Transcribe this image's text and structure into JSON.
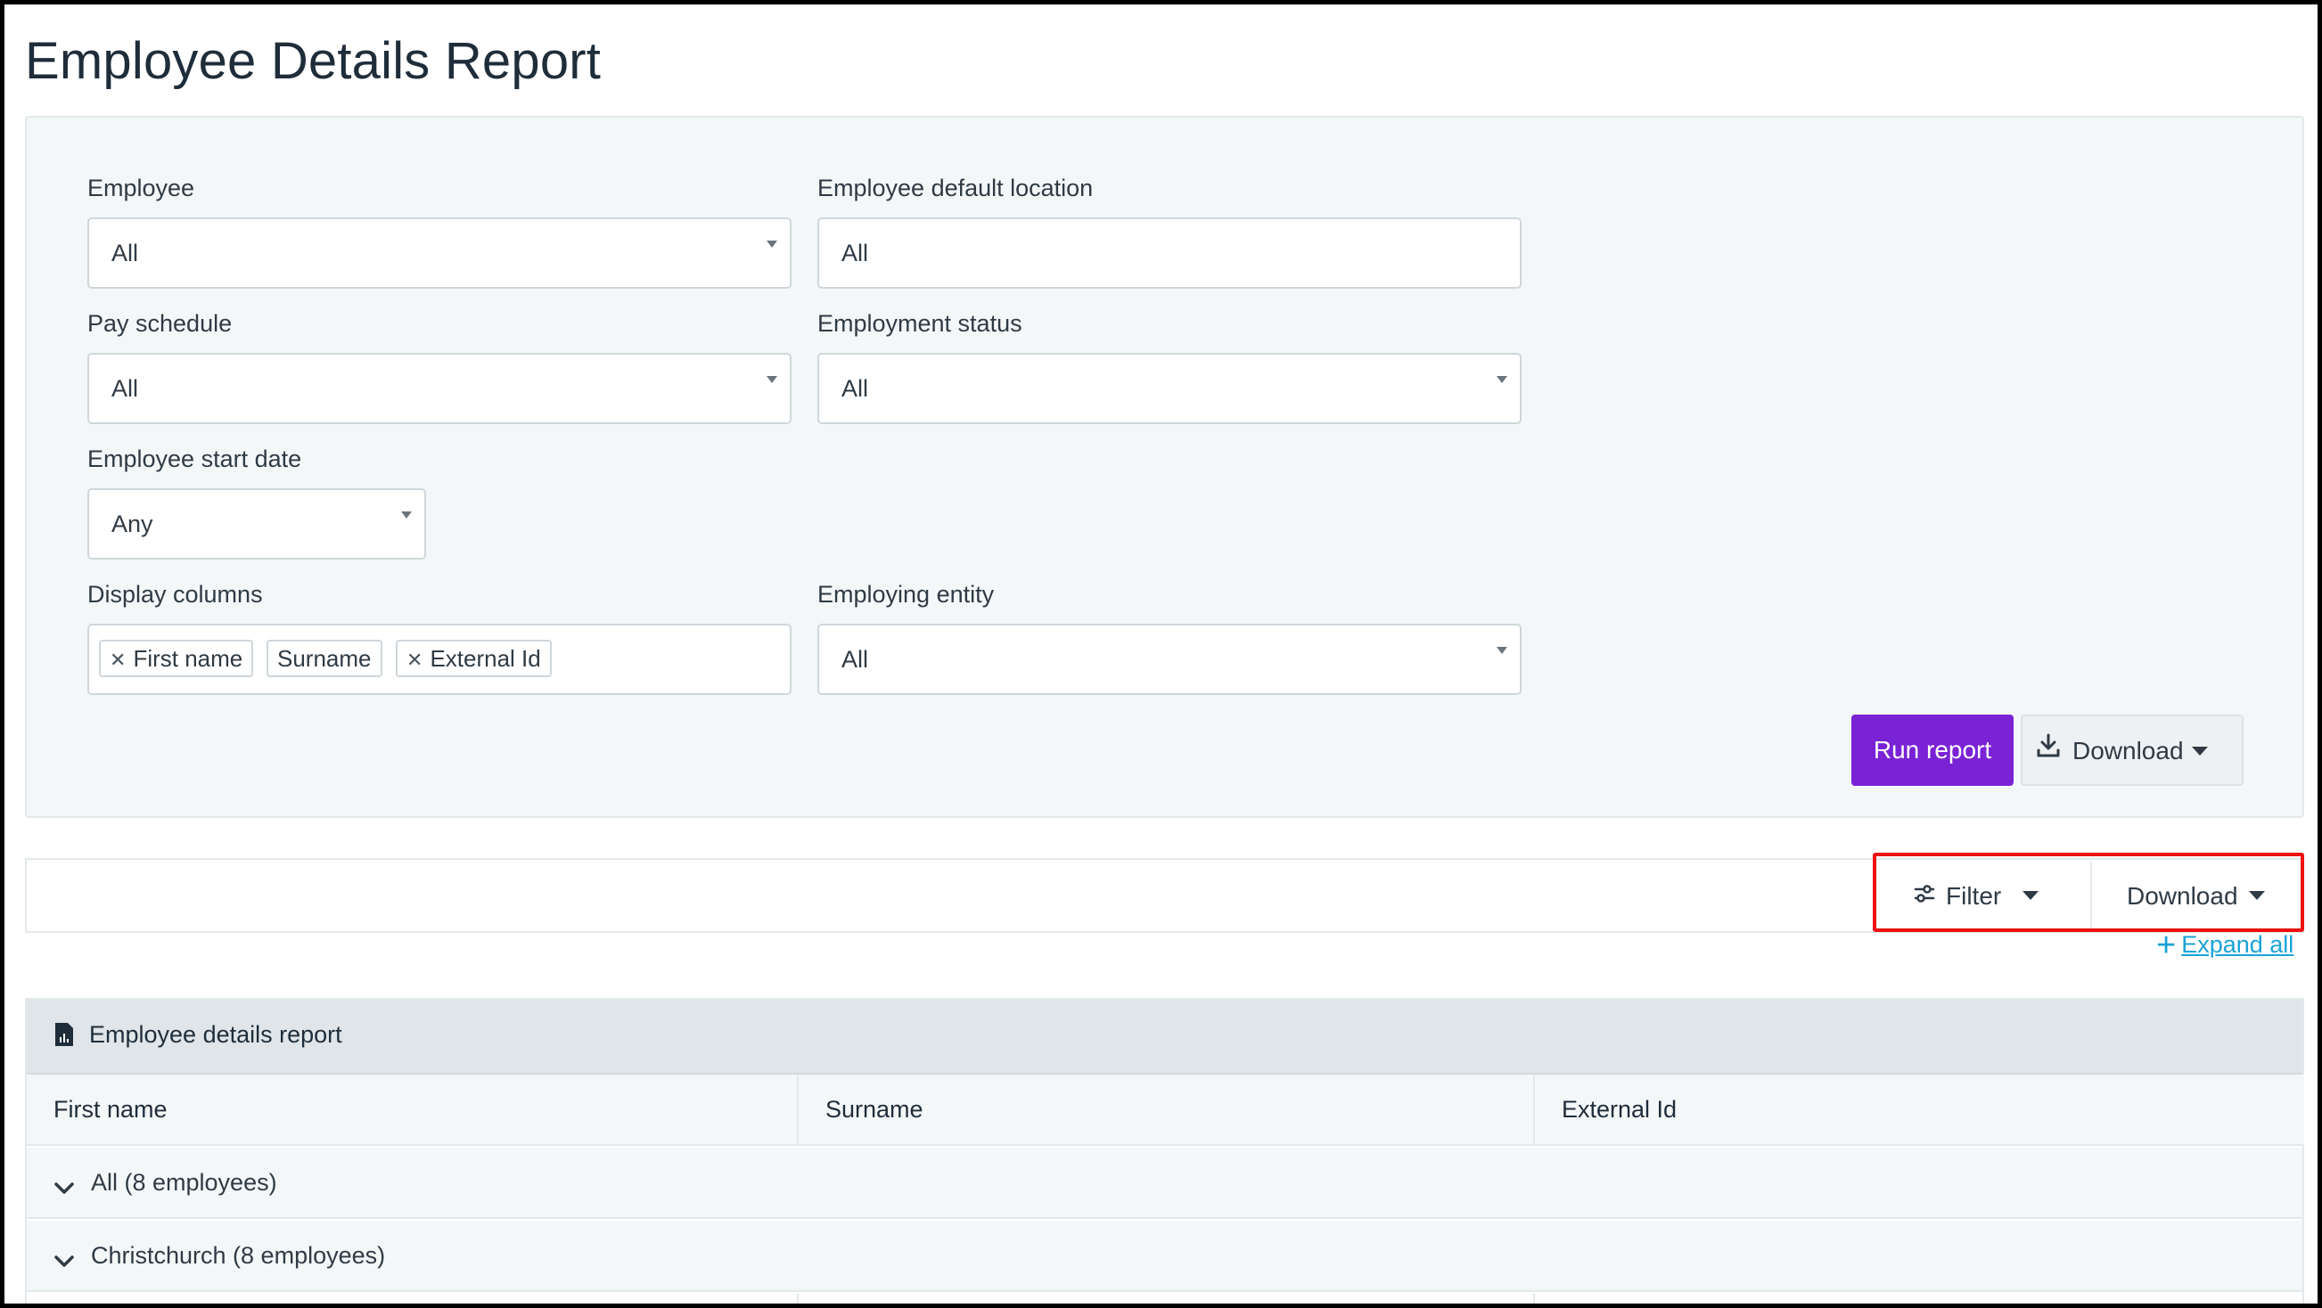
{
  "page": {
    "title": "Employee Details Report"
  },
  "filters": {
    "employee": {
      "label": "Employee",
      "value": "All"
    },
    "default_location": {
      "label": "Employee default location",
      "value": "All"
    },
    "pay_schedule": {
      "label": "Pay schedule",
      "value": "All"
    },
    "employment_status": {
      "label": "Employment status",
      "value": "All"
    },
    "start_date": {
      "label": "Employee start date",
      "value": "Any"
    },
    "display_columns": {
      "label": "Display columns",
      "tags": [
        "First name",
        "Surname",
        "External Id"
      ]
    },
    "employing_entity": {
      "label": "Employing entity",
      "value": "All"
    }
  },
  "actions": {
    "run_report": "Run report",
    "download": "Download"
  },
  "toolbar": {
    "filter": "Filter",
    "download": "Download",
    "expand_all": "Expand all"
  },
  "report": {
    "title": "Employee details report",
    "columns": [
      "First name",
      "Surname",
      "External Id"
    ],
    "groups": [
      {
        "label": "All (8 employees)"
      },
      {
        "label": "Christchurch (8 employees)"
      }
    ]
  },
  "colors": {
    "primary": "#7a22d6",
    "link": "#1aa3d6",
    "highlight": "#ee1111"
  }
}
